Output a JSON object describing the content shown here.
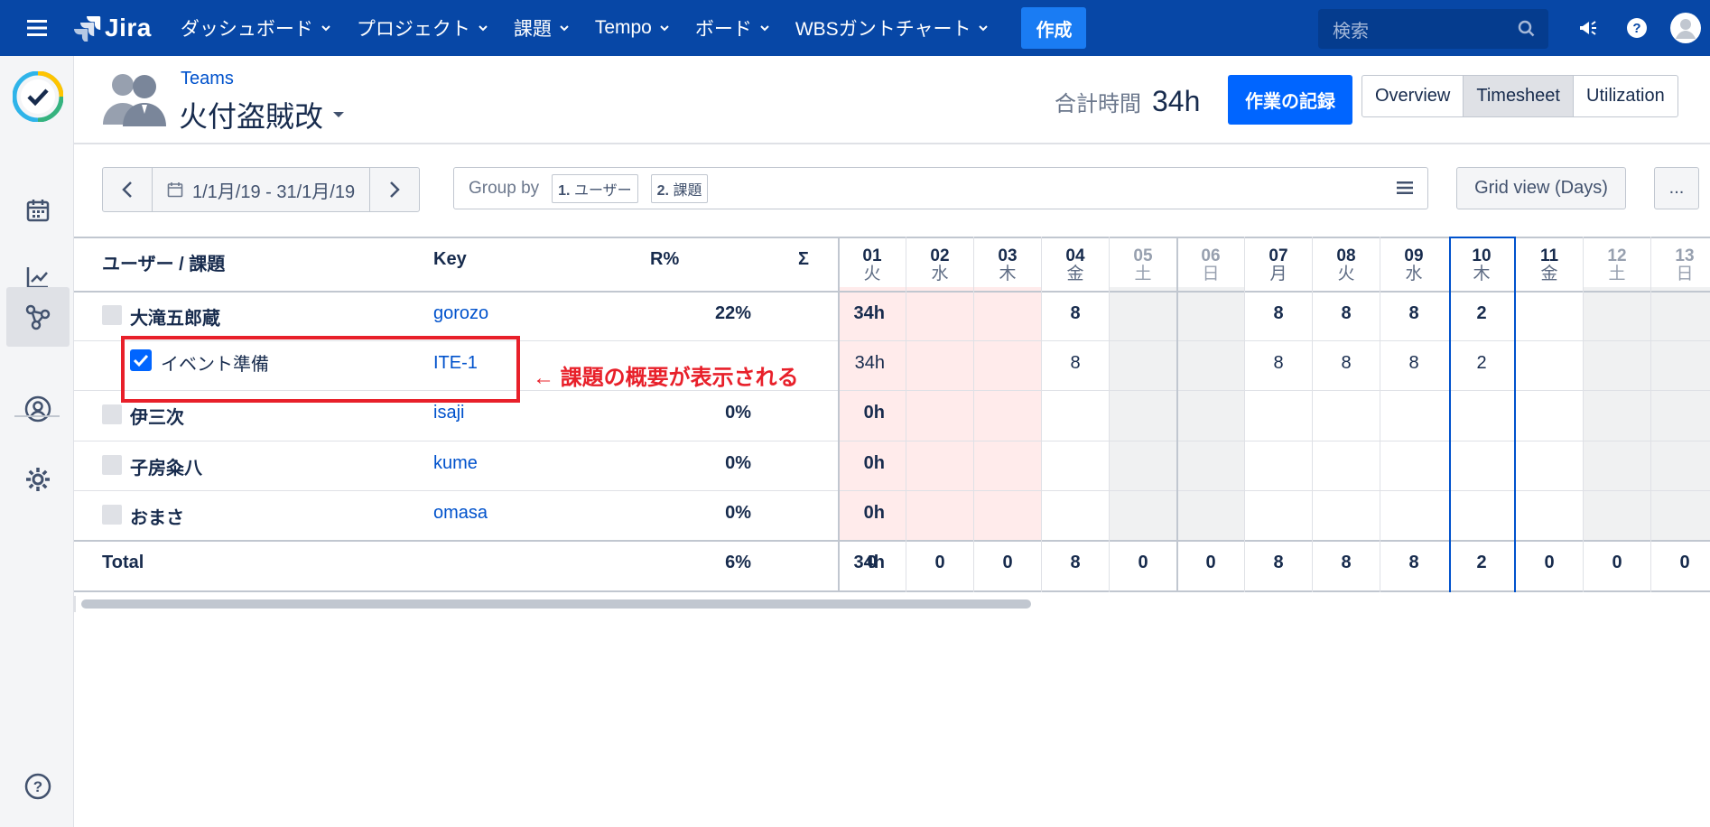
{
  "topnav": {
    "logo_text": "Jira",
    "items": [
      {
        "label": "ダッシュボード"
      },
      {
        "label": "プロジェクト"
      },
      {
        "label": "課題"
      },
      {
        "label": "Tempo"
      },
      {
        "label": "ボード"
      },
      {
        "label": "WBSガントチャート"
      }
    ],
    "create_label": "作成",
    "search_placeholder": "検索"
  },
  "header": {
    "breadcrumb": "Teams",
    "team_name": "火付盗賊改",
    "total_label": "合計時間",
    "total_value": "34h",
    "record_button": "作業の記録",
    "tabs": [
      "Overview",
      "Timesheet",
      "Utilization"
    ],
    "active_tab": "Timesheet"
  },
  "toolbar": {
    "date_range": "1/1月/19 - 31/1月/19",
    "group_by_label": "Group by",
    "group_chips": [
      {
        "num": "1.",
        "label": "ユーザー"
      },
      {
        "num": "2.",
        "label": "課題"
      }
    ],
    "grid_view_label": "Grid view (Days)",
    "more_label": "..."
  },
  "table": {
    "headers": {
      "user_issue": "ユーザー / 課題",
      "key": "Key",
      "r_pct": "R%",
      "sigma": "Σ"
    },
    "days": [
      {
        "num": "01",
        "wd": "火"
      },
      {
        "num": "02",
        "wd": "水"
      },
      {
        "num": "03",
        "wd": "木"
      },
      {
        "num": "04",
        "wd": "金"
      },
      {
        "num": "05",
        "wd": "土"
      },
      {
        "num": "06",
        "wd": "日"
      },
      {
        "num": "07",
        "wd": "月"
      },
      {
        "num": "08",
        "wd": "火"
      },
      {
        "num": "09",
        "wd": "水"
      },
      {
        "num": "10",
        "wd": "木"
      },
      {
        "num": "11",
        "wd": "金"
      },
      {
        "num": "12",
        "wd": "土"
      },
      {
        "num": "13",
        "wd": "日"
      }
    ],
    "rows": [
      {
        "name": "大滝五郎蔵",
        "key": "gorozo",
        "r": "22%",
        "sum": "34h",
        "type": "user",
        "cells": [
          "",
          "",
          "",
          "8",
          "",
          "",
          "8",
          "8",
          "8",
          "2",
          "",
          "",
          ""
        ]
      },
      {
        "name": "イベント準備",
        "key": "ITE-1",
        "r": "",
        "sum": "34h",
        "type": "issue",
        "cells": [
          "",
          "",
          "",
          "8",
          "",
          "",
          "8",
          "8",
          "8",
          "2",
          "",
          "",
          ""
        ]
      },
      {
        "name": "伊三次",
        "key": "isaji",
        "r": "0%",
        "sum": "0h",
        "type": "user",
        "cells": [
          "",
          "",
          "",
          "",
          "",
          "",
          "",
          "",
          "",
          "",
          "",
          "",
          ""
        ]
      },
      {
        "name": "子房粂八",
        "key": "kume",
        "r": "0%",
        "sum": "0h",
        "type": "user",
        "cells": [
          "",
          "",
          "",
          "",
          "",
          "",
          "",
          "",
          "",
          "",
          "",
          "",
          ""
        ]
      },
      {
        "name": "おまさ",
        "key": "omasa",
        "r": "0%",
        "sum": "0h",
        "type": "user",
        "cells": [
          "",
          "",
          "",
          "",
          "",
          "",
          "",
          "",
          "",
          "",
          "",
          "",
          ""
        ]
      }
    ],
    "total": {
      "label": "Total",
      "r": "6%",
      "sum": "34h",
      "cells": [
        "0",
        "0",
        "0",
        "8",
        "0",
        "0",
        "8",
        "8",
        "8",
        "2",
        "0",
        "0",
        "0"
      ]
    }
  },
  "annotation": {
    "text": "← 課題の概要が表示される"
  },
  "colors": {
    "nav_bg": "#0747a6",
    "primary": "#0065ff",
    "holiday_bg": "#ffebeb",
    "weekend_bg": "#f0f1f2",
    "today_border": "#0052cc",
    "callout_red": "#e8202a"
  }
}
